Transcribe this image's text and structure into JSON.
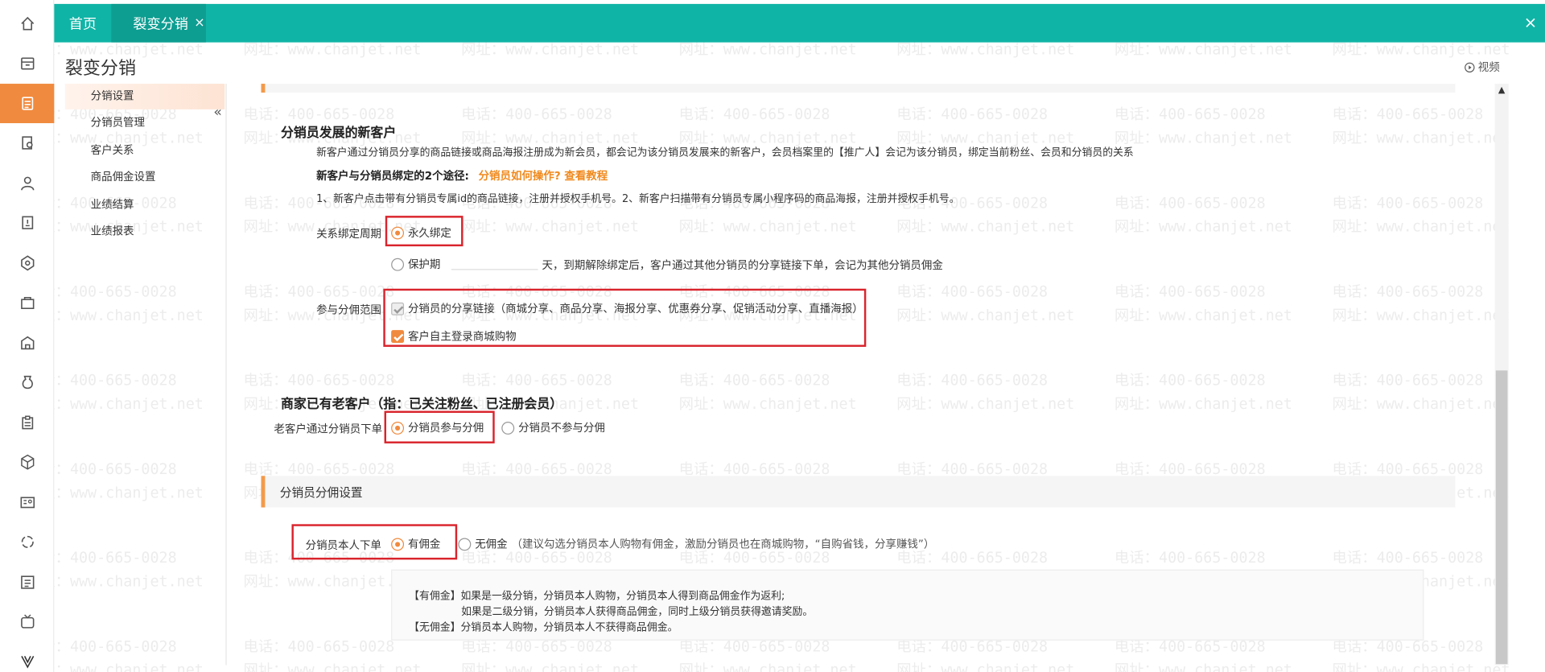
{
  "topbar": {
    "tabs": [
      {
        "label": "首页"
      },
      {
        "label": "裂变分销",
        "close": "×"
      }
    ],
    "close": "×"
  },
  "page": {
    "title": "裂变分销",
    "video_label": "视频"
  },
  "subnav": {
    "items": [
      {
        "label": "分销设置",
        "active": true
      },
      {
        "label": "分销员管理"
      },
      {
        "label": "客户关系"
      },
      {
        "label": "商品佣金设置"
      },
      {
        "label": "业绩结算"
      },
      {
        "label": "业绩报表"
      }
    ],
    "collapse_icon": "«"
  },
  "new_customers": {
    "heading": "分销员发展的新客户",
    "desc": "新客户通过分销员分享的商品链接或商品海报注册成为新会员，都会记为该分销员发展来的新客户，会员档案里的【推广人】会记为该分销员，绑定当前粉丝、会员和分销员的关系",
    "ways_label": "新客户与分销员绑定的2个途径:",
    "ways_link": "分销员如何操作? 查看教程",
    "ways_detail": "1、新客户点击带有分销员专属id的商品链接，注册并授权手机号。2、新客户扫描带有分销员专属小程序码的商品海报，注册并授权手机号。",
    "binding_label": "关系绑定周期",
    "opt_permanent": "永久绑定",
    "opt_protect": "保护期",
    "protect_suffix": "天，到期解除绑定后，客户通过其他分销员的分享链接下单，会记为其他分销员佣金",
    "scope_label": "参与分佣范围",
    "scope_opt1": "分销员的分享链接（商城分享、商品分享、海报分享、优惠券分享、促销活动分享、直播海报）",
    "scope_opt2": "客户自主登录商城购物"
  },
  "old_customers": {
    "heading": "商家已有老客户（指：已关注粉丝、已注册会员）",
    "label": "老客户通过分销员下单",
    "opt_yes": "分销员参与分佣",
    "opt_no": "分销员不参与分佣"
  },
  "commission_section": {
    "title": "分销员分佣设置",
    "self_order_label": "分销员本人下单",
    "opt_with": "有佣金",
    "opt_without": "无佣金",
    "without_note": "（建议勾选分销员本人购物有佣金，激励分销员也在商城购物，“自购省钱，分享赚钱”）",
    "tips": [
      "【有佣金】如果是一级分销，分销员本人购物，分销员本人得到商品佣金作为返利;",
      "如果是二级分销，分销员本人获得商品佣金，同时上级分销员获得邀请奖励。",
      "【无佣金】分销员本人购物，分销员本人不获得商品佣金。"
    ]
  },
  "watermark": {
    "phone": "电话：400-665-0028",
    "url": "网址：www.chanjet.net"
  },
  "colors": {
    "topbar": "#10b4a6",
    "accent": "#f08a3e",
    "highlight_box": "#d9242c"
  },
  "icons": [
    "home-icon",
    "store-icon",
    "distribution-icon",
    "doc-search-icon",
    "user-icon",
    "doc-icon",
    "settings-icon",
    "bag-icon",
    "building-icon",
    "money-bag-icon",
    "clipboard-icon",
    "cube-icon",
    "card-icon",
    "loop-icon",
    "list-icon",
    "tv-icon",
    "v-logo-icon"
  ]
}
